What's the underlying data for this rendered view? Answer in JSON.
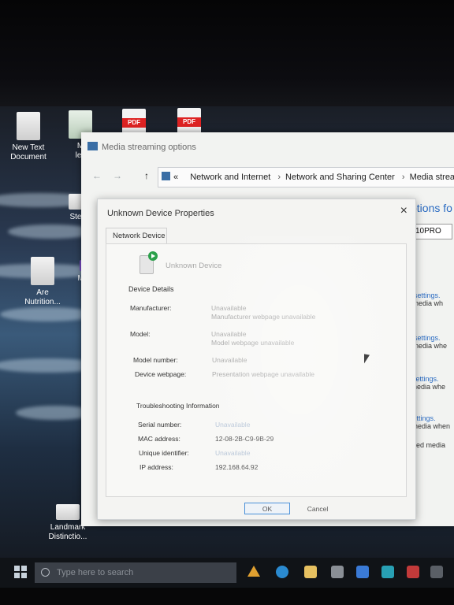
{
  "desktop": {
    "icons": [
      {
        "label": "New Text\nDocument",
        "type": "doc"
      },
      {
        "label": "M\nles",
        "type": "xls"
      },
      {
        "label": "",
        "type": "pdf",
        "badge": "PDF"
      },
      {
        "label": "",
        "type": "pdf",
        "badge": "PDF"
      },
      {
        "label": "Ste",
        "type": "doc"
      },
      {
        "label": "Are\nNutrition...",
        "type": "doc"
      },
      {
        "label": "Mes",
        "type": "doc"
      },
      {
        "label": "Landmark\nDistinctio...",
        "type": "doc"
      }
    ]
  },
  "media_window": {
    "title": "Media streaming options",
    "breadcrumb": [
      "Network and Internet",
      "Network and Sharing Center",
      "Media strea"
    ],
    "breadcrumb_prefix": "«",
    "heading": "ptions fo",
    "name_value": "10PRO",
    "right_items": [
      {
        "link": "ult settings.",
        "text": "ur media wh"
      },
      {
        "link": "ult settings.",
        "text": "ur media whe"
      },
      {
        "link": "ult settings.",
        "text": "ur media whe"
      },
      {
        "link": "ult settings.",
        "text": "our media when"
      },
      {
        "link": "",
        "text": "ir shared media"
      }
    ]
  },
  "dialog": {
    "title": "Unknown Device Properties",
    "close": "×",
    "tab": "Network Device",
    "device_name": "Unknown Device",
    "device_details_heading": "Device Details",
    "fields": [
      {
        "label": "Manufacturer:",
        "value": "Unavailable",
        "value2": "Manufacturer webpage unavailable"
      },
      {
        "label": "Model:",
        "value": "Unavailable",
        "value2": "Model webpage unavailable"
      },
      {
        "label": "Model number:",
        "value": "Unavailable",
        "value2": ""
      },
      {
        "label": "Device webpage:",
        "value": "Presentation webpage unavailable",
        "value2": ""
      }
    ],
    "troubleshooting_heading": "Troubleshooting Information",
    "troubleshooting": [
      {
        "label": "Serial number:",
        "value": "Unavailable"
      },
      {
        "label": "MAC address:",
        "value": "12-08-2B-C9-9B-29"
      },
      {
        "label": "Unique identifier:",
        "value": "Unavailable"
      },
      {
        "label": "IP address:",
        "value": "192.168.64.92"
      }
    ],
    "ok_label": "OK",
    "cancel_label": "Cancel"
  },
  "taskbar": {
    "search_placeholder": "Type here to search"
  },
  "colors": {
    "link_blue": "#2a6bc2",
    "ok_border": "#4a90d9",
    "taskbar": "#101317"
  }
}
